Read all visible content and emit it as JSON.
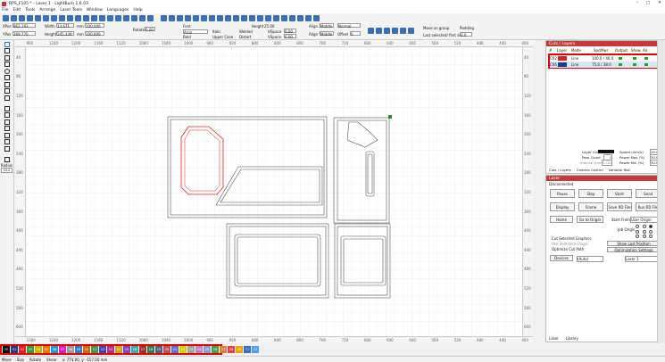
{
  "window": {
    "title": "RPS_F105 * - Laser 1 - LightBurn 1.6.03"
  },
  "menu": [
    "File",
    "Edit",
    "Tools",
    "Arrange",
    "Laser Tools",
    "Window",
    "Languages",
    "Help"
  ],
  "numeric": {
    "xpos_label": "XPos",
    "xpos": "862.193",
    "ypos_label": "YPos",
    "ypos": "269.770",
    "width_label": "Width",
    "width": "13.671",
    "height_label": "Height",
    "height": "245.339",
    "width_pct": "100.000",
    "height_pct": "100.000",
    "unit": "mm",
    "rotate_label": "Rotate",
    "rotate": "0.00",
    "font_label": "Font",
    "font": "Arial",
    "bold": "Bold",
    "italic": "Italic",
    "upper_case": "Upper Case",
    "welded": "Welded",
    "distort": "Distort",
    "height2_label": "Height",
    "height2": "25.00",
    "hspace_label": "HSpace",
    "hspace": "0.00",
    "vspace_label": "VSpace",
    "vspace": "0.00",
    "align_x_label": "Align X",
    "align_x": "Middle",
    "align_y_label": "Align Y",
    "align_y": "Middle",
    "normal": "Normal",
    "offset_label": "Offset",
    "offset": "0",
    "move_as_group": "Move as group",
    "last_lock": "Last selected/ first selected",
    "padding_label": "Padding",
    "padding": "0.0"
  },
  "ruler": {
    "top": [
      "960",
      "1240",
      "1200",
      "1160",
      "1120",
      "1080",
      "1040",
      "1000",
      "960",
      "920",
      "880",
      "840",
      "800",
      "760",
      "720",
      "680",
      "640",
      "600",
      "560",
      "520",
      "480",
      "440",
      "400"
    ],
    "left": [
      "40",
      "80",
      "120",
      "160",
      "200",
      "240",
      "280",
      "320",
      "360",
      "400",
      "440",
      "480",
      "520",
      "560",
      "600"
    ],
    "right": [
      "40",
      "80",
      "120",
      "160",
      "200",
      "240",
      "280",
      "320",
      "360",
      "400",
      "440",
      "480",
      "520",
      "560",
      "600"
    ],
    "bottom": [
      "1280",
      "1240",
      "1200",
      "1160",
      "1120",
      "1080",
      "1040",
      "1000",
      "960",
      "920",
      "880",
      "840",
      "800",
      "760",
      "720",
      "680",
      "640",
      "600",
      "560",
      "520",
      "480",
      "440",
      "400"
    ]
  },
  "cuts_layers": {
    "title": "Cuts / Layers",
    "headers": [
      "#",
      "Layer",
      "Mode",
      "Spd/Pwr",
      "Output",
      "Show",
      "Air"
    ],
    "rows": [
      {
        "num": "C02",
        "mode": "Line",
        "spdpwr": "100.0 / 40.0",
        "color": "#e02020"
      },
      {
        "num": "C06",
        "mode": "Line",
        "spdpwr": "75.0 / 38.0",
        "color": "#1e3a8a"
      }
    ],
    "layer_color_label": "Layer Color",
    "speed_label": "Speed (mm/s)",
    "speed": "15.00",
    "pass_count_label": "Pass Count",
    "pass_count": "1",
    "power_max_label": "Power Max (%)",
    "power_max": "30.00",
    "interval_label": "Interval (mm)",
    "interval": "0.100",
    "power_min_label": "Power Min (%)",
    "power_min": "30.00",
    "tabs": [
      "Cuts / Layers",
      "Camera Control",
      "Variable Text"
    ]
  },
  "laser": {
    "title": "Laser",
    "status": "Disconnected",
    "pause": "Pause",
    "stop": "Stop",
    "start": "Start",
    "send": "Send",
    "display": "Display",
    "frame": "Frame",
    "save_rd": "Save RD File",
    "run_rd": "Run RD File",
    "home": "Home",
    "go_to_origin": "Go to Origin",
    "start_from_label": "Start From:",
    "start_from": "User Origin",
    "job_origin_label": "Job Origin",
    "cut_selected": "Cut Selected Graphics",
    "use_selection_origin": "Use Selection Origin",
    "optimize_cut_path": "Optimize Cut Path",
    "show_last_position": "Show Last Position",
    "optimization_settings": "Optimization Settings",
    "devices": "Devices",
    "auto": "(Auto)",
    "device_name": "Laser 1",
    "tabs": [
      "Laser",
      "Library"
    ]
  },
  "palette": [
    {
      "label": "00",
      "color": "#000000"
    },
    {
      "label": "01",
      "color": "#1e3a8a"
    },
    {
      "label": "02",
      "color": "#e02020"
    },
    {
      "label": "03",
      "color": "#2f9e2f"
    },
    {
      "label": "04",
      "color": "#c8b400"
    },
    {
      "label": "05",
      "color": "#e07a00"
    },
    {
      "label": "06",
      "color": "#1a9bd7"
    },
    {
      "label": "07",
      "color": "#d020d0"
    },
    {
      "label": "08",
      "color": "#999999"
    },
    {
      "label": "09",
      "color": "#2a7ed0"
    },
    {
      "label": "10",
      "color": "#cc6600"
    },
    {
      "label": "11",
      "color": "#3a9a4a"
    },
    {
      "label": "12",
      "color": "#4040c0"
    },
    {
      "label": "13",
      "color": "#b03080"
    },
    {
      "label": "14",
      "color": "#d0a020"
    },
    {
      "label": "15",
      "color": "#8040c0"
    },
    {
      "label": "16",
      "color": "#30b0b0"
    },
    {
      "label": "17",
      "color": "#a03030"
    },
    {
      "label": "18",
      "color": "#2a8050"
    },
    {
      "label": "19",
      "color": "#506080"
    },
    {
      "label": "20",
      "color": "#c05050"
    },
    {
      "label": "21",
      "color": "#6070d0"
    },
    {
      "label": "22",
      "color": "#d0d000"
    },
    {
      "label": "23",
      "color": "#a0a0a0"
    },
    {
      "label": "24",
      "color": "#c080c0"
    },
    {
      "label": "25",
      "color": "#80a0d0"
    },
    {
      "label": "26",
      "color": "#40a040"
    },
    {
      "label": "27",
      "color": "#d08040"
    },
    {
      "label": "28",
      "color": "#e04040"
    },
    {
      "label": "29",
      "color": "#f0a000"
    },
    {
      "label": "T1",
      "color": "#3070c0"
    },
    {
      "label": "T2",
      "color": "#50a0e0"
    }
  ],
  "status_bar": {
    "move": "Move",
    "size": "Size",
    "rotate": "Rotate",
    "shear": "Shear",
    "coords": "x: 774.00, y: -157.00 mm"
  },
  "left_tools": {
    "radius_label": "Radius",
    "radius": "10.0"
  }
}
